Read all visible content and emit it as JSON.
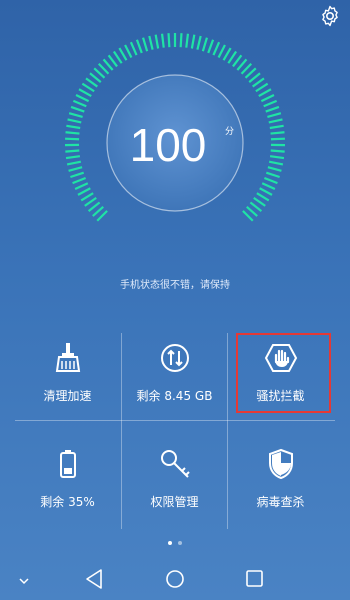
{
  "header": {
    "settings_icon": "gear-icon"
  },
  "score": {
    "value": "100",
    "unit": "分",
    "max": 100
  },
  "status_text": "手机状态很不错，请保持",
  "tiles": [
    {
      "label": "清理加速",
      "icon": "broom-icon"
    },
    {
      "label": "剩余 8.45 GB",
      "icon": "data-transfer-icon"
    },
    {
      "label": "骚扰拦截",
      "icon": "hand-shield-icon"
    },
    {
      "label": "剩余 35%",
      "icon": "battery-icon"
    },
    {
      "label": "权限管理",
      "icon": "key-icon"
    },
    {
      "label": "病毒查杀",
      "icon": "shield-icon"
    }
  ],
  "pager": {
    "count": 2,
    "active": 0
  },
  "nav": {
    "back": "back-icon",
    "home": "home-icon",
    "recents": "recents-icon",
    "down": "chevron-down-icon"
  },
  "colors": {
    "accent": "#1fe3a5",
    "highlight": "#e53935"
  }
}
